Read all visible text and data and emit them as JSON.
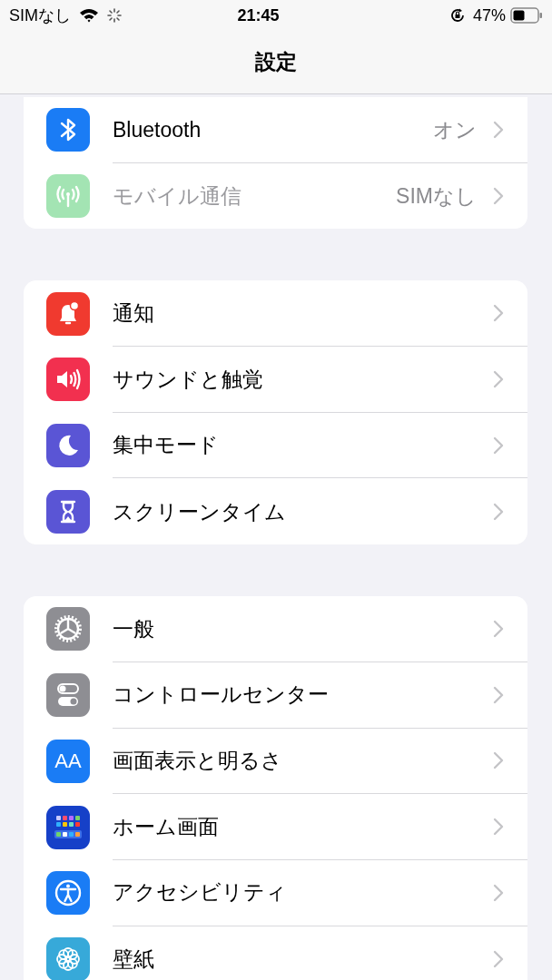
{
  "status_bar": {
    "carrier": "SIMなし",
    "time": "21:45",
    "battery": "47%"
  },
  "nav_bar": {
    "title": "設定"
  },
  "groups": [
    {
      "items": [
        {
          "label": "Bluetooth",
          "value": "オン",
          "color": "#1a7cf5",
          "disabled": false
        },
        {
          "label": "モバイル通信",
          "value": "SIMなし",
          "color": "#a3e4b3",
          "disabled": true
        }
      ]
    },
    {
      "items": [
        {
          "label": "通知",
          "color": "#f03a2f",
          "disabled": false
        },
        {
          "label": "サウンドと触覚",
          "color": "#f2304f",
          "disabled": false
        },
        {
          "label": "集中モード",
          "color": "#5a55d5",
          "disabled": false
        },
        {
          "label": "スクリーンタイム",
          "color": "#5a55d5",
          "disabled": false
        }
      ]
    },
    {
      "items": [
        {
          "label": "一般",
          "color": "#8e8e93",
          "disabled": false
        },
        {
          "label": "コントロールセンター",
          "color": "#8e8e93",
          "disabled": false
        },
        {
          "label": "画面表示と明るさ",
          "color": "#1a7cf5",
          "disabled": false,
          "icon_text": "AA"
        },
        {
          "label": "ホーム画面",
          "color": "#1640c8",
          "disabled": false
        },
        {
          "label": "アクセシビリティ",
          "color": "#1a7cf5",
          "disabled": false
        },
        {
          "label": "壁紙",
          "color": "#37a9d9",
          "disabled": false
        }
      ]
    }
  ]
}
